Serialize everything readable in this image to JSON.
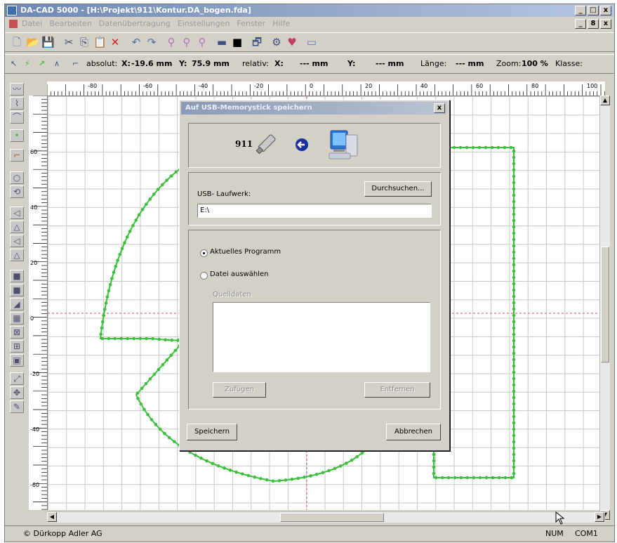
{
  "window": {
    "title": "DA-CAD 5000 - [H:\\Projekt\\911\\Kontur.DA_bogen.fda]",
    "minimize": "_",
    "maximize": "□",
    "close": "x",
    "mdi_restore": "8"
  },
  "menu": {
    "items": [
      "Datei",
      "Bearbeiten",
      "Datenübertragung",
      "Einstellungen",
      "Fenster",
      "Hilfe"
    ]
  },
  "coords": {
    "absolut_label": "absolut:",
    "x_label": "X:",
    "x_value": "-19.6 mm",
    "y_label": "Y:",
    "y_value": "75.9 mm",
    "relativ_label": "relativ:",
    "rx_label": "X:",
    "rx_value": "--- mm",
    "ry_label": "Y:",
    "ry_value": "--- mm",
    "laenge_label": "Länge:",
    "laenge_value": "--- mm",
    "zoom_label": "Zoom:",
    "zoom_value": "100 %",
    "klasse_label": "Klasse:"
  },
  "ruler": {
    "top": [
      "-80",
      "-60",
      "-40",
      "-20",
      "0",
      "20",
      "40",
      "60",
      "80",
      "100"
    ],
    "left": [
      "60",
      "40",
      "20",
      "0",
      "-20",
      "-40",
      "-60"
    ]
  },
  "dialog": {
    "title": "Auf USB-Memorystick speichern",
    "close": "x",
    "program_number": "911",
    "usb_label": "USB- Laufwerk:",
    "browse_button": "Durchsuchen...",
    "drive_value": "E:\\",
    "radio_current": "Aktuelles Programm",
    "radio_file": "Datei auswählen",
    "source_label": "Quelldaten",
    "add_button": "Zufügen",
    "remove_button": "Entfernen",
    "save_button": "Speichern",
    "cancel_button": "Abbrechen"
  },
  "status": {
    "company": "© Dürkopp Adler AG",
    "num": "NUM",
    "port": "COM1"
  },
  "colors": {
    "contour": "#3cc03c",
    "crosshair": "#e04080",
    "grid": "#c8c8c8"
  }
}
